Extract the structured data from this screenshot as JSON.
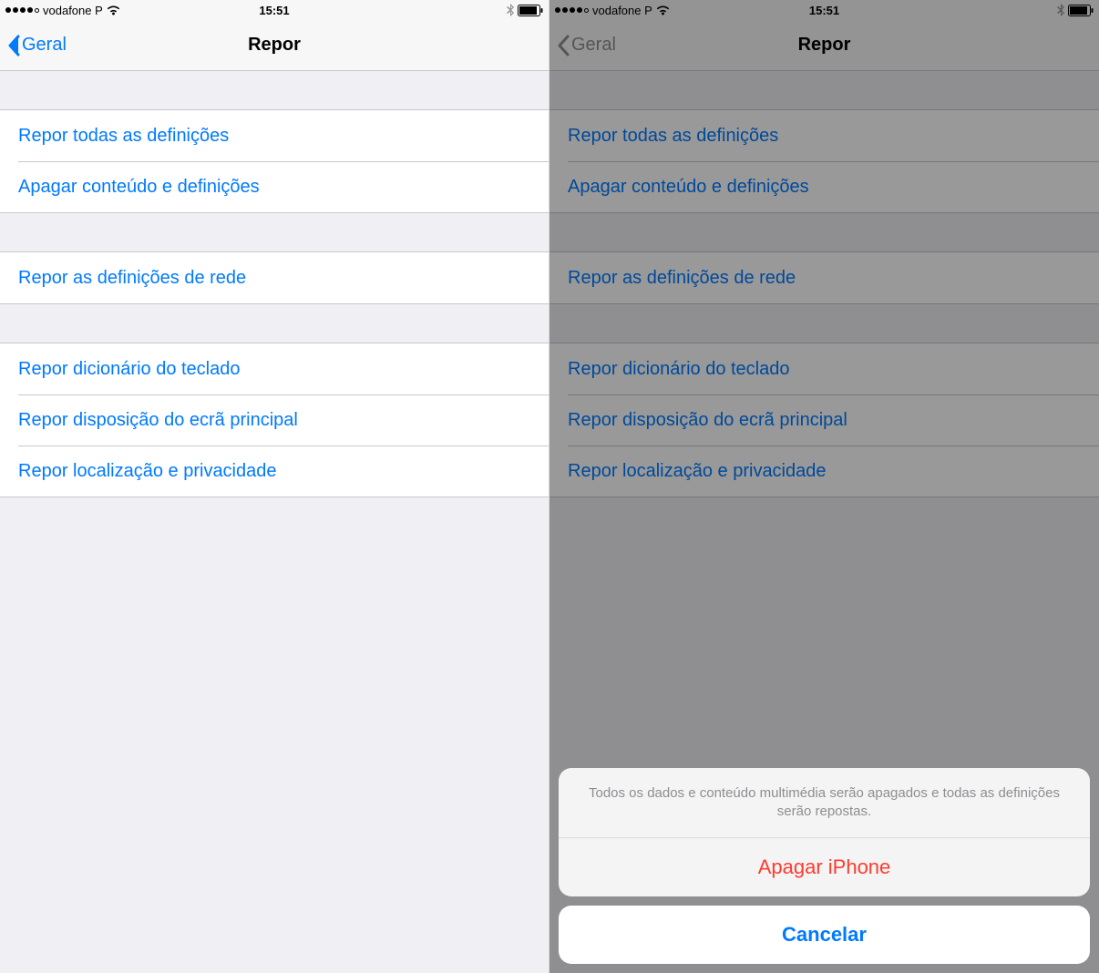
{
  "status": {
    "carrier": "vodafone P",
    "time": "15:51"
  },
  "nav": {
    "back_label": "Geral",
    "title": "Repor"
  },
  "groups": [
    {
      "rows": [
        {
          "label": "Repor todas as definições"
        },
        {
          "label": "Apagar conteúdo e definições"
        }
      ]
    },
    {
      "rows": [
        {
          "label": "Repor as definições de rede"
        }
      ]
    },
    {
      "rows": [
        {
          "label": "Repor dicionário do teclado"
        },
        {
          "label": "Repor disposição do ecrã principal"
        },
        {
          "label": "Repor localização e privacidade"
        }
      ]
    }
  ],
  "action_sheet": {
    "message": "Todos os dados e conteúdo multimédia serão apagados e todas as definições serão repostas.",
    "destructive_label": "Apagar iPhone",
    "cancel_label": "Cancelar"
  },
  "colors": {
    "link": "#007aff",
    "destructive": "#ff3b30",
    "separator": "#c8c7cc",
    "background": "#efeff4"
  }
}
